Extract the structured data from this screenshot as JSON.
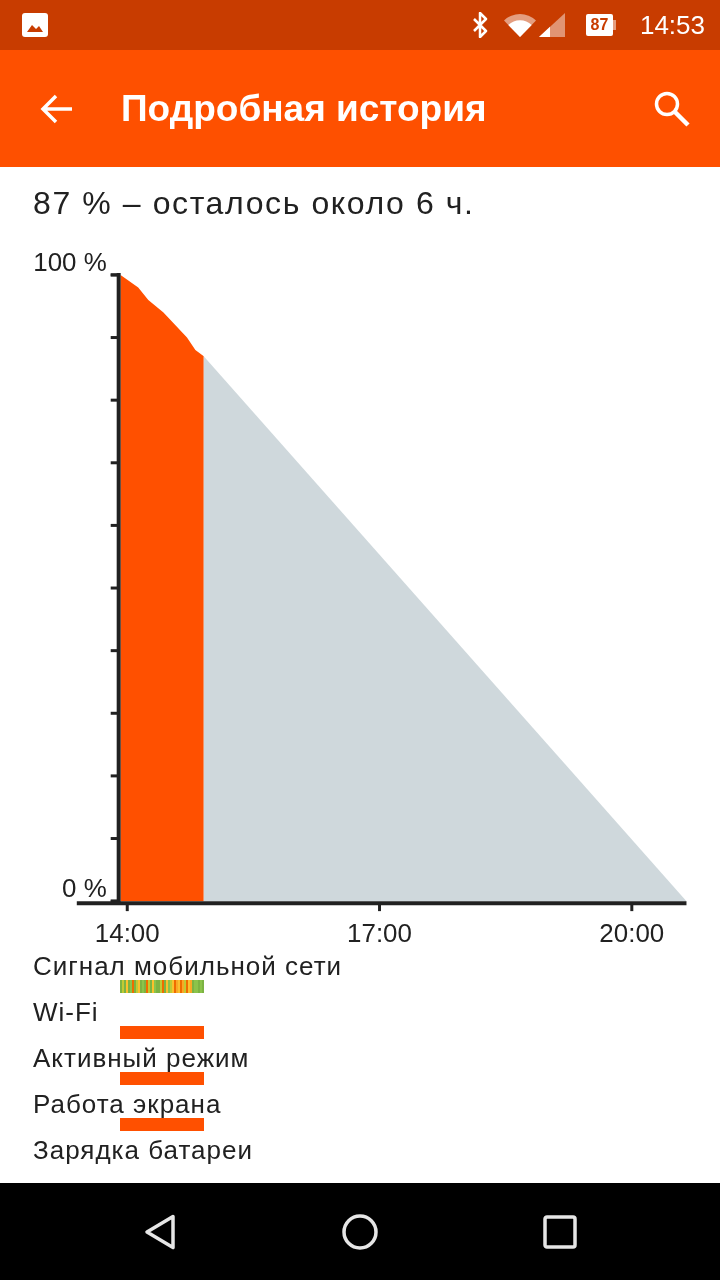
{
  "status_bar": {
    "battery": "87",
    "time": "14:53"
  },
  "app_bar": {
    "title": "Подробная история"
  },
  "summary": "87 % – осталось около 6 ч.",
  "chart": {
    "chart_data": {
      "type": "area",
      "x": [
        13.92,
        14.13,
        14.25,
        14.43,
        14.57,
        14.71,
        14.81,
        14.91,
        20.65
      ],
      "series": [
        {
          "color": "#ff5000",
          "values": [
            100,
            98,
            96,
            94,
            92,
            90,
            88,
            87,
            null
          ]
        },
        {
          "color": "#cfd8dc",
          "values": [
            null,
            null,
            null,
            null,
            null,
            null,
            null,
            87,
            0
          ]
        }
      ],
      "xlim": [
        13.4,
        20.65
      ],
      "ylim": [
        0,
        100
      ],
      "xticks": [
        {
          "value": 14,
          "label": "14:00"
        },
        {
          "value": 17,
          "label": "17:00"
        },
        {
          "value": 20,
          "label": "20:00"
        }
      ],
      "yticks": [
        {
          "value": 0,
          "label": "0 %"
        },
        {
          "value": 100,
          "label": "100 %"
        }
      ]
    }
  },
  "legend": [
    {
      "label": "Сигнал мобильной сети",
      "kind": "signal"
    },
    {
      "label": "Wi-Fi",
      "kind": "state",
      "on": true
    },
    {
      "label": "Активный режим",
      "kind": "state",
      "on": true
    },
    {
      "label": "Работа экрана",
      "kind": "state",
      "on": true
    },
    {
      "label": "Зарядка батареи",
      "kind": "state",
      "on": false
    }
  ]
}
